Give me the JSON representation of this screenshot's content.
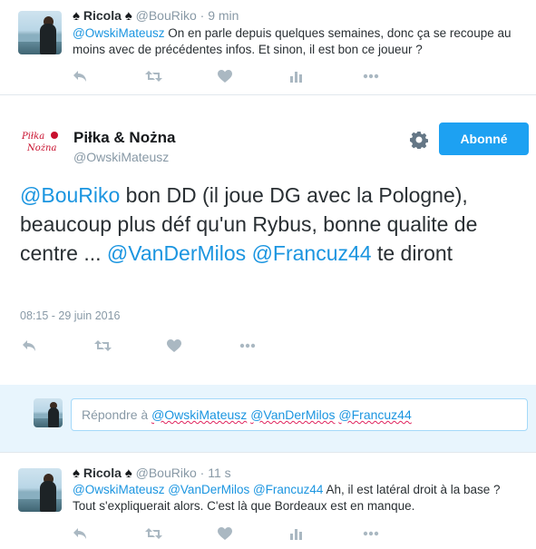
{
  "tweet1": {
    "name": "Ricola",
    "spade_left": "♠",
    "spade_right": "♠",
    "handle": "@BouRiko",
    "dot": "·",
    "time": "9 min",
    "mention": "@OwskiMateusz",
    "text": " On en parle depuis quelques semaines, donc ça se recoupe au moins avec de précédentes infos. Et sinon, il est bon ce joueur ?"
  },
  "main_tweet": {
    "logo_text": "Piłka Nożna",
    "name": "Piłka & Nożna",
    "handle": "@OwskiMateusz",
    "follow_label": "Abonné",
    "text_parts": {
      "m1": "@BouRiko",
      "t1": " bon DD (il joue DG avec la Pologne), beaucoup plus déf qu'un Rybus, bonne qualite de centre ... ",
      "m2": "@VanDerMilos",
      "t2": " ",
      "m3": "@Francuz44",
      "t3": " te diront"
    },
    "timestamp": "08:15 - 29 juin 2016"
  },
  "reply_box": {
    "prefix": "Répondre à ",
    "mention1": "@OwskiMateusz",
    "mention2": "@VanDerMilos",
    "mention3": "@Francuz44"
  },
  "tweet3": {
    "name": "Ricola",
    "spade_left": "♠",
    "spade_right": "♠",
    "handle": "@BouRiko",
    "dot": "·",
    "time": "11 s",
    "mentions": "@OwskiMateusz @VanDerMilos @Francuz44",
    "text": " Ah, il est latéral droit à la base ? Tout s'expliquerait alors. C'est là que Bordeaux est en manque."
  },
  "icons": [
    "reply-icon",
    "retweet-icon",
    "like-icon",
    "analytics-icon",
    "more-icon",
    "gear-icon"
  ],
  "colors": {
    "link": "#1b95e0",
    "follow_button": "#1da1f2",
    "reply_area": "#e8f5fd",
    "muted": "#8899a6"
  }
}
